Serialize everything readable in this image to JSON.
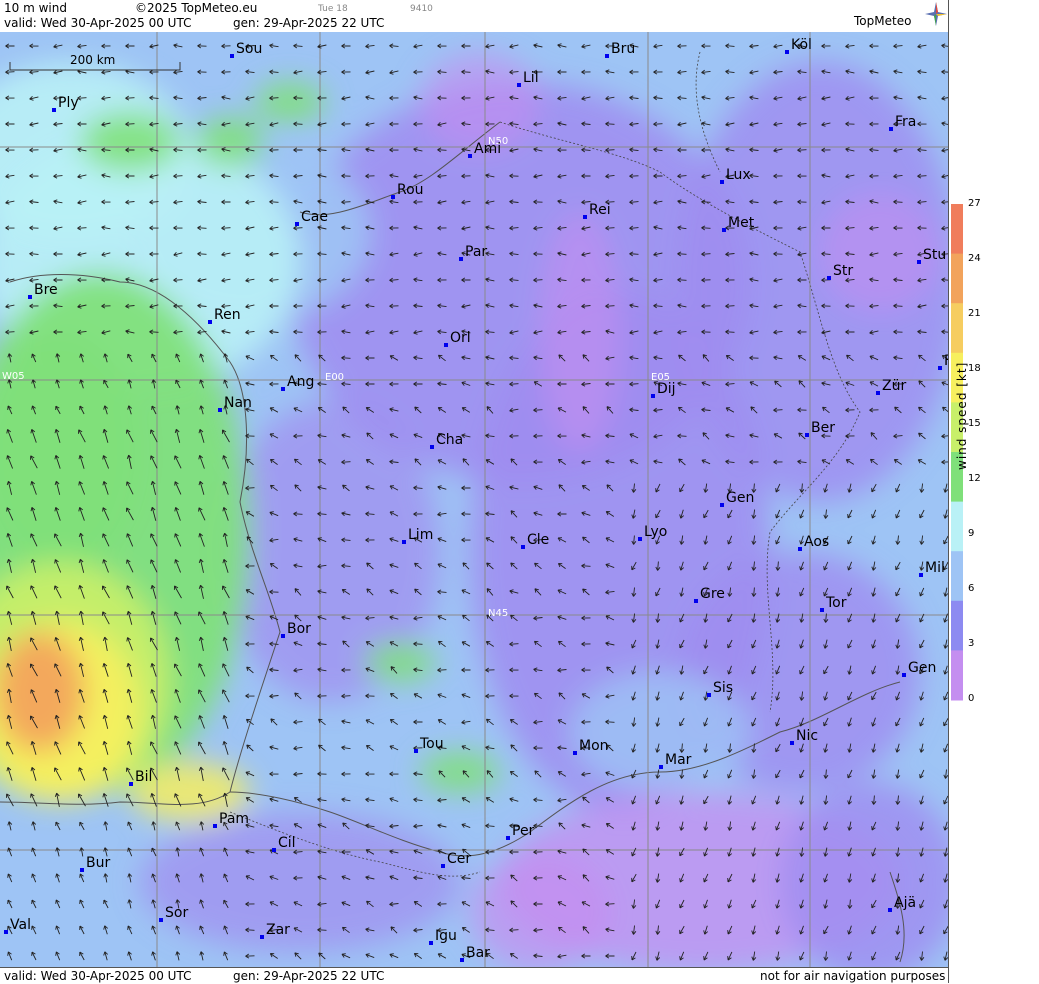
{
  "header": {
    "product": "10 m wind",
    "copyright": "©2025 TopMeteo.eu",
    "valid": "valid:  Wed  30-Apr-2025  00 UTC",
    "gen": "gen: 29-Apr-2025 22 UTC",
    "run_tag": "Tue 18",
    "code": "9410",
    "brand": "TopMeteo"
  },
  "footer": {
    "valid": "valid:  Wed  30-Apr-2025  00 UTC",
    "gen": "gen: 29-Apr-2025 22 UTC",
    "disclaimer": "not for air navigation purposes"
  },
  "map": {
    "scale_label": "200 km",
    "grid_labels": [
      "N50",
      "N45",
      "W05",
      "E00",
      "E05"
    ],
    "cities": [
      "Sou",
      "Bru",
      "Köl",
      "Ply",
      "Lil",
      "Ami",
      "Fra",
      "Lux",
      "Rou",
      "Rei",
      "Cae",
      "Met",
      "Par",
      "Stu",
      "Bre",
      "Str",
      "Ren",
      "Orl",
      "F",
      "Ang",
      "Dij",
      "Zür",
      "Nan",
      "Ber",
      "Cha",
      "Gen",
      "Lim",
      "Cle",
      "Lyo",
      "Aos",
      "Mil",
      "Gre",
      "Tor",
      "Bor",
      "Gen",
      "Sis",
      "Tou",
      "Mon",
      "Nic",
      "Mar",
      "Bil",
      "Per",
      "Pam",
      "Cil",
      "Cer",
      "Bur",
      "Ajä",
      "Sor",
      "Val",
      "Zar",
      "Igu",
      "Bar"
    ],
    "colors": {
      "calm": "#c48ef0",
      "light": "#9f8cf0",
      "moderate": "#9ec4f5",
      "breeze": "#b9f1f6",
      "fresh": "#7fe07a",
      "strong": "#f5f065",
      "gale": "#f2a05a",
      "city_marker": "#0000ee"
    }
  },
  "legend": {
    "title": "wind speed [kt]",
    "ticks": [
      "27",
      "24",
      "21",
      "18",
      "15",
      "12",
      "9",
      "6",
      "3",
      "0"
    ],
    "colors": [
      "#f07d5c",
      "#f2a35c",
      "#f6cd60",
      "#f7ef5e",
      "#c8ef6a",
      "#7fe07a",
      "#b9f1f6",
      "#9ec4f5",
      "#8d8af1",
      "#c48ef0"
    ]
  }
}
